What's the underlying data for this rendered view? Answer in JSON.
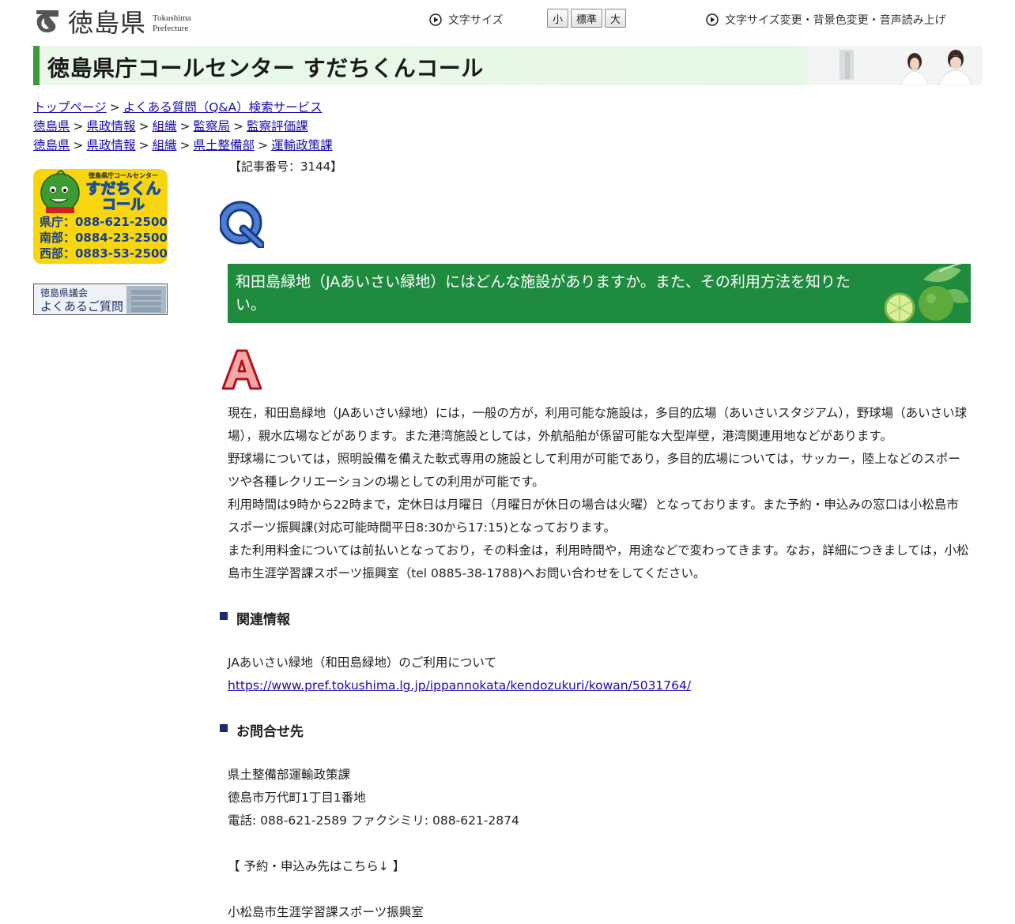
{
  "header": {
    "logo_jp": "徳島県",
    "logo_en_line1": "Tokushima",
    "logo_en_line2": "Prefecture",
    "font_size_label": "文字サイズ",
    "font_size_buttons": [
      "小",
      "標準",
      "大"
    ],
    "accessibility_link": "文字サイズ変更・背景色変更・音声読み上げ"
  },
  "banner": {
    "title": "徳島県庁コールセンター すだちくんコール"
  },
  "breadcrumbs": [
    [
      "トップページ",
      "よくある質問（Q&A）検索サービス"
    ],
    [
      "徳島県",
      "県政情報",
      "組織",
      "監察局",
      "監察評価課"
    ],
    [
      "徳島県",
      "県政情報",
      "組織",
      "県土整備部",
      "運輸政策課"
    ]
  ],
  "breadcrumb_separator": ">",
  "sidebar": {
    "callcenter_banner": {
      "heading": "徳島県庁コールセンター",
      "name_line1": "すだちくん",
      "name_line2": "コール",
      "phones": [
        "県庁：088-621-2500",
        "南部：0884-23-2500",
        "西部：0883-53-2500"
      ]
    },
    "assembly_banner": {
      "line1": "徳島県議会",
      "line2": "よくあるご質問"
    }
  },
  "article": {
    "number": "【記事番号：3144】",
    "question": "和田島緑地（JAあいさい緑地）にはどんな施設がありますか。また、その利用方法を知りたい。",
    "answer_paragraphs": [
      "現在，和田島緑地（JAあいさい緑地）には，一般の方が，利用可能な施設は，多目的広場（あいさいスタジアム），野球場（あいさい球場），親水広場などがあります。また港湾施設としては，外航船舶が係留可能な大型岸壁，港湾関連用地などがあります。",
      "野球場については，照明設備を備えた軟式専用の施設として利用が可能であり，多目的広場については，サッカー，陸上などのスポーツや各種レクリエーションの場としての利用が可能です。",
      "利用時間は9時から22時まで，定休日は月曜日（月曜日が休日の場合は火曜）となっております。また予約・申込みの窓口は小松島市スポーツ振興課(対応可能時間平日8:30から17:15)となっております。",
      "また利用料金については前払いとなっており，その料金は，利用時間や，用途などで変わってきます。なお，詳細につきましては，小松島市生涯学習課スポーツ振興室（tel 0885-38-1788)へお問い合わせをしてください。"
    ]
  },
  "related": {
    "heading": "関連情報",
    "text": "JAあいさい緑地（和田島緑地）のご利用について",
    "url": "https://www.pref.tokushima.lg.jp/ippannokata/kendozukuri/kowan/5031764/"
  },
  "contact": {
    "heading": "お問合せ先",
    "dept": "県土整備部運輸政策課",
    "address": "徳島市万代町1丁目1番地",
    "phone_fax": "電話: 088-621-2589 ファクシミリ: 088-621-2874",
    "reservation_note": "【 予約・申込み先はこちら↓ 】",
    "reservation_office": "小松島市生涯学習課スポーツ振興室"
  },
  "colors": {
    "banner_accent": "#3c9a3c",
    "question_bg": "#1f8b3f",
    "link": "#1a0dab",
    "section_square": "#1d2a6e",
    "q_icon": "#1e4a9a",
    "a_icon": "#c8141e"
  }
}
